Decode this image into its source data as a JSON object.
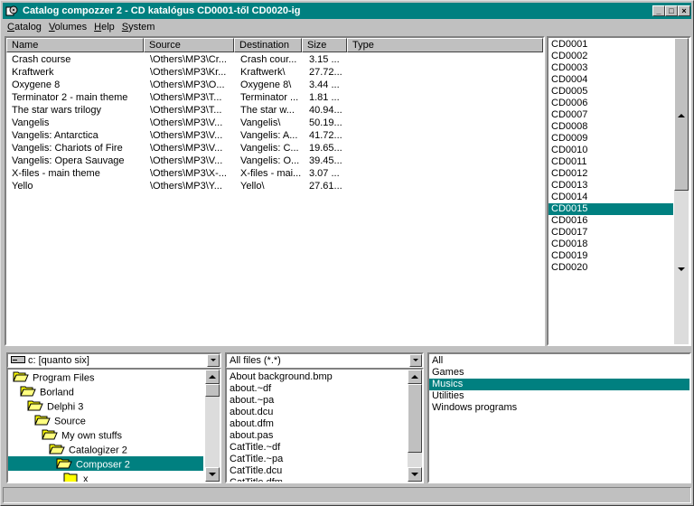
{
  "window": {
    "title": "Catalog compozzer 2 - CD katalógus CD0001-től CD0020-ig"
  },
  "titlebar_buttons": {
    "minimize": "_",
    "maximize": "□",
    "close": "×"
  },
  "menu": [
    "Catalog",
    "Volumes",
    "Help",
    "System"
  ],
  "file_table": {
    "columns": [
      "Name",
      "Source",
      "Destination",
      "Size",
      "Type"
    ],
    "rows": [
      {
        "name": "Crash course",
        "source": "\\Others\\MP3\\Cr...",
        "dest": "Crash cour...",
        "size": "3.15 ..."
      },
      {
        "name": "Kraftwerk",
        "source": "\\Others\\MP3\\Kr...",
        "dest": "Kraftwerk\\",
        "size": "27.72..."
      },
      {
        "name": "Oxygene 8",
        "source": "\\Others\\MP3\\O...",
        "dest": "Oxygene 8\\",
        "size": "3.44 ..."
      },
      {
        "name": "Terminator 2 - main theme",
        "source": "\\Others\\MP3\\T...",
        "dest": "Terminator ...",
        "size": "1.81 ..."
      },
      {
        "name": "The star wars trilogy",
        "source": "\\Others\\MP3\\T...",
        "dest": "The star w...",
        "size": "40.94..."
      },
      {
        "name": "Vangelis",
        "source": "\\Others\\MP3\\V...",
        "dest": "Vangelis\\",
        "size": "50.19..."
      },
      {
        "name": "Vangelis: Antarctica",
        "source": "\\Others\\MP3\\V...",
        "dest": "Vangelis: A...",
        "size": "41.72..."
      },
      {
        "name": "Vangelis: Chariots of Fire",
        "source": "\\Others\\MP3\\V...",
        "dest": "Vangelis: C...",
        "size": "19.65..."
      },
      {
        "name": "Vangelis: Opera Sauvage",
        "source": "\\Others\\MP3\\V...",
        "dest": "Vangelis: O...",
        "size": "39.45..."
      },
      {
        "name": "X-files - main theme",
        "source": "\\Others\\MP3\\X-...",
        "dest": "X-files - mai...",
        "size": "3.07 ..."
      },
      {
        "name": "Yello",
        "source": "\\Others\\MP3\\Y...",
        "dest": "Yello\\",
        "size": "27.61..."
      }
    ]
  },
  "volumes": {
    "items": [
      "CD0001",
      "CD0002",
      "CD0003",
      "CD0004",
      "CD0005",
      "CD0006",
      "CD0007",
      "CD0008",
      "CD0009",
      "CD0010",
      "CD0011",
      "CD0012",
      "CD0013",
      "CD0014",
      "CD0015",
      "CD0016",
      "CD0017",
      "CD0018",
      "CD0019",
      "CD0020"
    ],
    "selected": "CD0015"
  },
  "drive": {
    "value": "c: [quanto six]"
  },
  "tree": {
    "items": [
      {
        "label": "Program Files",
        "depth": 0,
        "open": true
      },
      {
        "label": "Borland",
        "depth": 1,
        "open": true
      },
      {
        "label": "Delphi 3",
        "depth": 2,
        "open": true
      },
      {
        "label": "Source",
        "depth": 3,
        "open": true
      },
      {
        "label": "My own stuffs",
        "depth": 4,
        "open": true
      },
      {
        "label": "Catalogizer 2",
        "depth": 5,
        "open": true
      },
      {
        "label": "Composer 2",
        "depth": 6,
        "open": true,
        "selected": true
      },
      {
        "label": "x",
        "depth": 7,
        "open": false
      }
    ]
  },
  "filter": {
    "value": "All files (*.*)"
  },
  "files": [
    "About background.bmp",
    "about.~df",
    "about.~pa",
    "about.dcu",
    "about.dfm",
    "about.pas",
    "CatTitle.~df",
    "CatTitle.~pa",
    "CatTitle.dcu",
    "CatTitle.dfm"
  ],
  "categories": {
    "items": [
      "All",
      "Games",
      "Musics",
      "Utilities",
      "Windows programs"
    ],
    "selected": "Musics"
  },
  "colors": {
    "selection": "#008080",
    "face": "#c0c0c0",
    "title": "#008080"
  }
}
